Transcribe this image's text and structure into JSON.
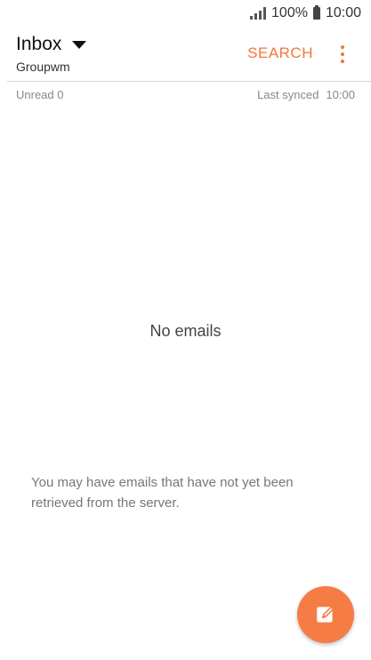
{
  "status_bar": {
    "battery": "100%",
    "time": "10:00"
  },
  "app_bar": {
    "folder_title": "Inbox",
    "account_name": "Groupwm",
    "search_label": "SEARCH"
  },
  "info_row": {
    "unread": "Unread 0",
    "last_synced_label": "Last synced",
    "last_synced_time": "10:00"
  },
  "empty_state": {
    "title": "No emails",
    "hint": "You may have emails that have not yet been retrieved from the server."
  },
  "colors": {
    "accent": "#f2763a",
    "fab": "#f57c45"
  },
  "icons": {
    "signal": "signal-icon",
    "battery": "battery-icon",
    "dropdown": "dropdown-icon",
    "more": "more-vert-icon",
    "compose": "compose-icon"
  }
}
